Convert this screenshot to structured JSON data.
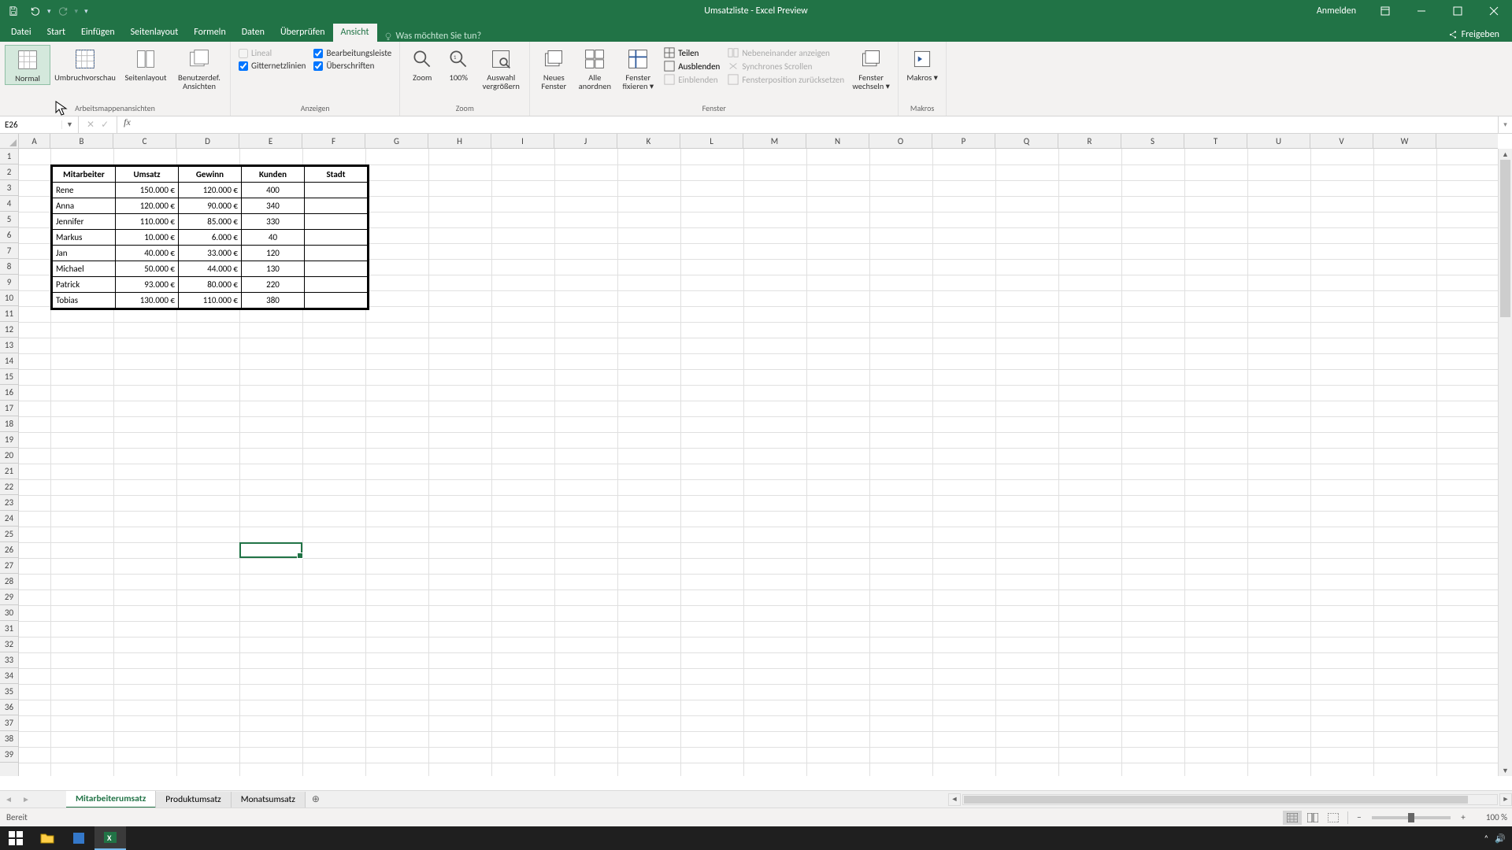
{
  "title": "Umsatzliste - Excel Preview",
  "signin": "Anmelden",
  "share": "Freigeben",
  "tabs": {
    "datei": "Datei",
    "start": "Start",
    "einfuegen": "Einfügen",
    "seitenlayout": "Seitenlayout",
    "formeln": "Formeln",
    "daten": "Daten",
    "ueberpruefen": "Überprüfen",
    "ansicht": "Ansicht",
    "tellme": "Was möchten Sie tun?"
  },
  "ribbon": {
    "views": {
      "normal": "Normal",
      "umbruch": "Umbruchvorschau",
      "seitenlayout": "Seitenlayout",
      "benutzerdef": "Benutzerdef. Ansichten",
      "group": "Arbeitsmappenansichten"
    },
    "anzeigen": {
      "lineal": "Lineal",
      "bearbeitungsleiste": "Bearbeitungsleiste",
      "gitternetz": "Gitternetzlinien",
      "ueberschriften": "Überschriften",
      "group": "Anzeigen"
    },
    "zoom": {
      "zoom": "Zoom",
      "hundred": "100%",
      "auswahl": "Auswahl vergrößern",
      "group": "Zoom"
    },
    "fenster": {
      "neues": "Neues Fenster",
      "alle": "Alle anordnen",
      "fixieren": "Fenster fixieren ▾",
      "teilen": "Teilen",
      "ausblenden": "Ausblenden",
      "einblenden": "Einblenden",
      "neben": "Nebeneinander anzeigen",
      "sync": "Synchrones Scrollen",
      "pos": "Fensterposition zurücksetzen",
      "wechseln": "Fenster wechseln ▾",
      "group": "Fenster"
    },
    "makros": {
      "makros": "Makros ▾",
      "group": "Makros"
    }
  },
  "namebox": "E26",
  "columns": [
    "A",
    "B",
    "C",
    "D",
    "E",
    "F",
    "G",
    "H",
    "I",
    "J",
    "K",
    "L",
    "M",
    "N",
    "O",
    "P",
    "Q",
    "R",
    "S",
    "T",
    "U",
    "V",
    "W"
  ],
  "row_count": 39,
  "table": {
    "headers": [
      "Mitarbeiter",
      "Umsatz",
      "Gewinn",
      "Kunden",
      "Stadt"
    ],
    "rows": [
      [
        "Rene",
        "150.000 €",
        "120.000 €",
        "400",
        ""
      ],
      [
        "Anna",
        "120.000 €",
        "90.000 €",
        "340",
        ""
      ],
      [
        "Jennifer",
        "110.000 €",
        "85.000 €",
        "330",
        ""
      ],
      [
        "Markus",
        "10.000 €",
        "6.000 €",
        "40",
        ""
      ],
      [
        "Jan",
        "40.000 €",
        "33.000 €",
        "120",
        ""
      ],
      [
        "Michael",
        "50.000 €",
        "44.000 €",
        "130",
        ""
      ],
      [
        "Patrick",
        "93.000 €",
        "80.000 €",
        "220",
        ""
      ],
      [
        "Tobias",
        "130.000 €",
        "110.000 €",
        "380",
        ""
      ]
    ]
  },
  "sheets": {
    "s1": "Mitarbeiterumsatz",
    "s2": "Produktumsatz",
    "s3": "Monatsumsatz"
  },
  "status": {
    "ready": "Bereit",
    "zoom": "100 %"
  }
}
